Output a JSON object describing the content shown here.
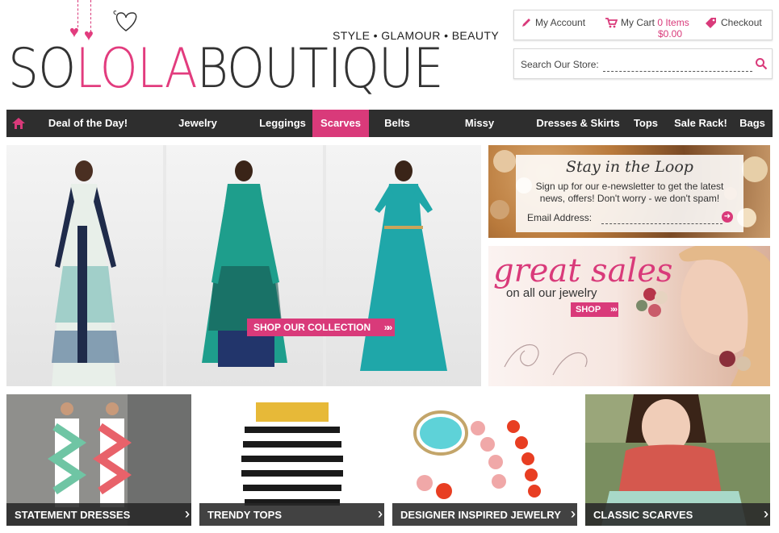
{
  "header": {
    "tagline": "STYLE • GLAMOUR • BEAUTY",
    "logo": {
      "part1": "SO",
      "part2": "LOLA",
      "part3": "BOUTIQUE"
    }
  },
  "account": {
    "my_account": "My Account",
    "my_cart": "My Cart",
    "cart_items": "0 Items",
    "cart_total": "$0.00",
    "checkout": "Checkout"
  },
  "search": {
    "label": "Search Our Store:",
    "value": ""
  },
  "nav": {
    "items": [
      {
        "label": "Deal of the Day!"
      },
      {
        "label": "Jewelry"
      },
      {
        "label": "Leggings"
      },
      {
        "label": "Scarves"
      },
      {
        "label": "Belts"
      },
      {
        "label": "Missy"
      },
      {
        "label": "Dresses & Skirts"
      },
      {
        "label": "Tops"
      },
      {
        "label": "Sale Rack!"
      },
      {
        "label": "Bags"
      }
    ]
  },
  "hero": {
    "button": "SHOP OUR COLLECTION"
  },
  "newsletter": {
    "title": "Stay in the Loop",
    "text": "Sign up for our e-newsletter to get the latest news, offers! Don't worry - we don't spam!",
    "email_label": "Email Address:"
  },
  "sales": {
    "title": "great sales",
    "subtitle": "on all our jewelry",
    "button": "SHOP"
  },
  "tiles": [
    {
      "label": "STATEMENT DRESSES"
    },
    {
      "label": "TRENDY TOPS"
    },
    {
      "label": "DESIGNER INSPIRED JEWELRY"
    },
    {
      "label": "CLASSIC SCARVES"
    }
  ],
  "colors": {
    "accent": "#d93a7a",
    "nav_bg": "#2e2e2e"
  }
}
